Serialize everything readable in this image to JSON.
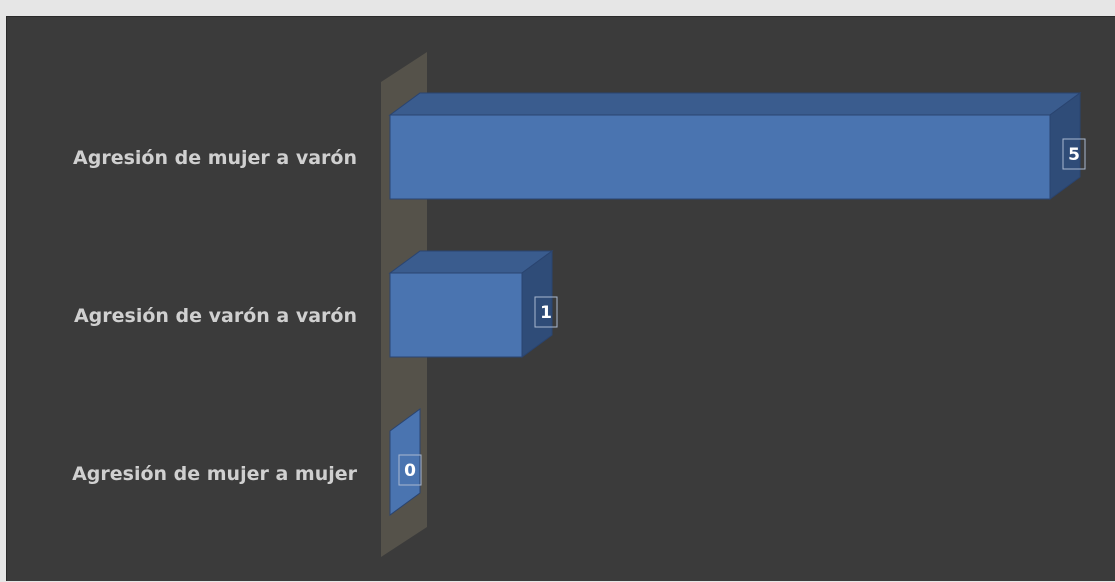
{
  "chart_data": {
    "type": "bar",
    "orientation": "horizontal",
    "style": "3d",
    "categories": [
      "Agresión de mujer a varón",
      "Agresión de varón a varón",
      "Agresión de mujer a mujer"
    ],
    "values": [
      5,
      1,
      0
    ],
    "data_labels": [
      "5",
      "1",
      "0"
    ],
    "title": "",
    "xlabel": "",
    "ylabel": "",
    "xlim": [
      0,
      5
    ],
    "grid": false,
    "legend": "none",
    "colors": {
      "bar_front": "#4a74b0",
      "bar_top": "#3a5c8e",
      "bar_side": "#2f4c78",
      "bar_edge": "#2a4470",
      "wall": "#55524a",
      "background": "#3b3b3b",
      "page": "#e6e6e6",
      "label": "#d0d0d0",
      "value_label": "#ffffff"
    }
  }
}
